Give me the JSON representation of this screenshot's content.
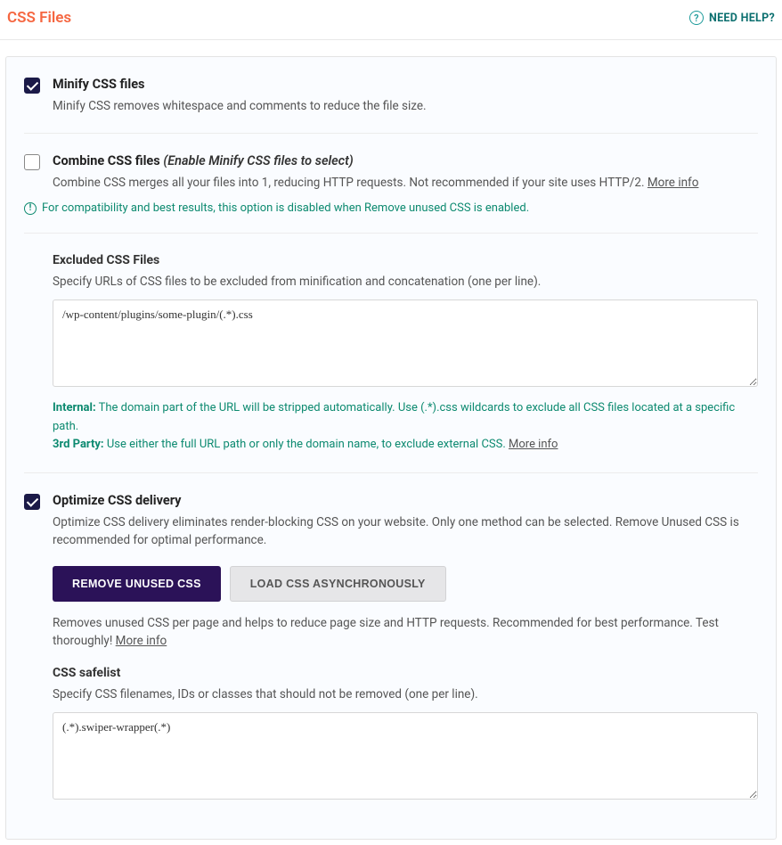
{
  "header": {
    "title": "CSS Files",
    "help": "NEED HELP?"
  },
  "options": {
    "minify": {
      "title": "Minify CSS files",
      "desc": "Minify CSS removes whitespace and comments to reduce the file size."
    },
    "combine": {
      "title": "Combine CSS files",
      "disabled_note": "(Enable Minify CSS files to select)",
      "desc": "Combine CSS merges all your files into 1, reducing HTTP requests. Not recommended if your site uses HTTP/2.",
      "more": "More info",
      "notice": "For compatibility and best results, this option is disabled when Remove unused CSS is enabled."
    },
    "excluded": {
      "title": "Excluded CSS Files",
      "desc": "Specify URLs of CSS files to be excluded from minification and concatenation (one per line).",
      "value": "/wp-content/plugins/some-plugin/(.*).css",
      "hint_internal_label": "Internal:",
      "hint_internal": "The domain part of the URL will be stripped automatically. Use (.*).css wildcards to exclude all CSS files located at a specific path.",
      "hint_3rd_label": "3rd Party:",
      "hint_3rd": "Use either the full URL path or only the domain name, to exclude external CSS.",
      "more": "More info"
    },
    "optimize": {
      "title": "Optimize CSS delivery",
      "desc": "Optimize CSS delivery eliminates render-blocking CSS on your website. Only one method can be selected. Remove Unused CSS is recommended for optimal performance.",
      "tab_remove": "REMOVE UNUSED CSS",
      "tab_async": "LOAD CSS ASYNCHRONOUSLY",
      "remove_desc": "Removes unused CSS per page and helps to reduce page size and HTTP requests. Recommended for best performance. Test thoroughly!",
      "more": "More info"
    },
    "safelist": {
      "title": "CSS safelist",
      "desc": "Specify CSS filenames, IDs or classes that should not be removed (one per line).",
      "value": "(.*).swiper-wrapper(.*)"
    }
  }
}
